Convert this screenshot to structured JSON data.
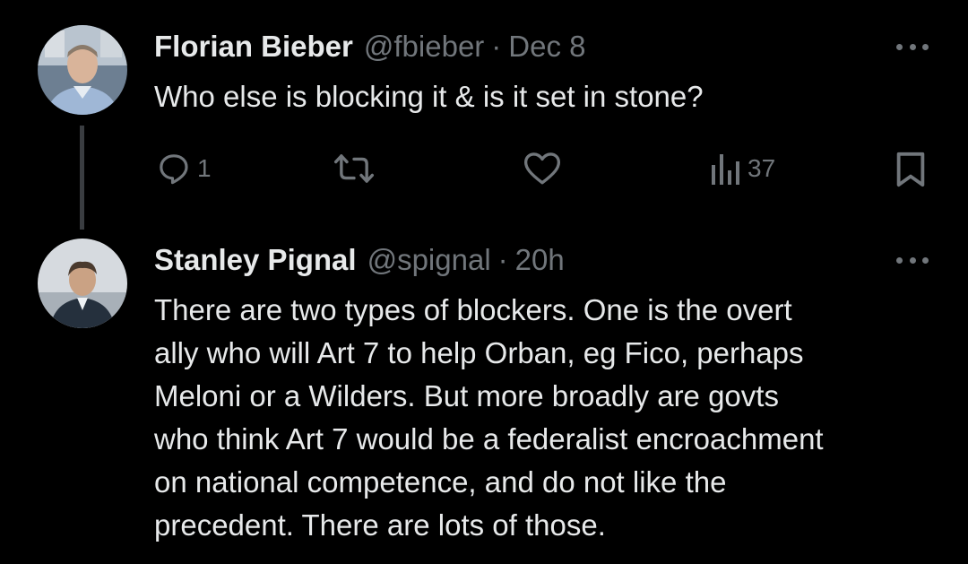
{
  "tweets": [
    {
      "author_name": "Florian Bieber",
      "handle": "@fbieber",
      "separator": "·",
      "time": "Dec 8",
      "text_lines": [
        "Who else is blocking it & is it set in stone?"
      ],
      "actions": {
        "reply_count": "1",
        "views_count": "37"
      },
      "avatar": {
        "icon": "person-photo",
        "bg": "#8fa3b8"
      }
    },
    {
      "author_name": "Stanley Pignal",
      "handle": "@spignal",
      "separator": "·",
      "time": "20h",
      "text_lines": [
        "There are two types of blockers. One is the overt",
        "ally who will Art 7 to help Orban, eg Fico, perhaps",
        "Meloni or a Wilders. But more broadly are govts",
        "who think Art 7 would be a federalist encroachment",
        "on national competence, and do not like the",
        "precedent. There are lots of those."
      ],
      "avatar": {
        "icon": "person-photo",
        "bg": "#c9ced3"
      }
    }
  ],
  "colors": {
    "background": "#000000",
    "text": "#e7e9ea",
    "muted": "#71767b",
    "thread_line": "#3a3d41"
  }
}
